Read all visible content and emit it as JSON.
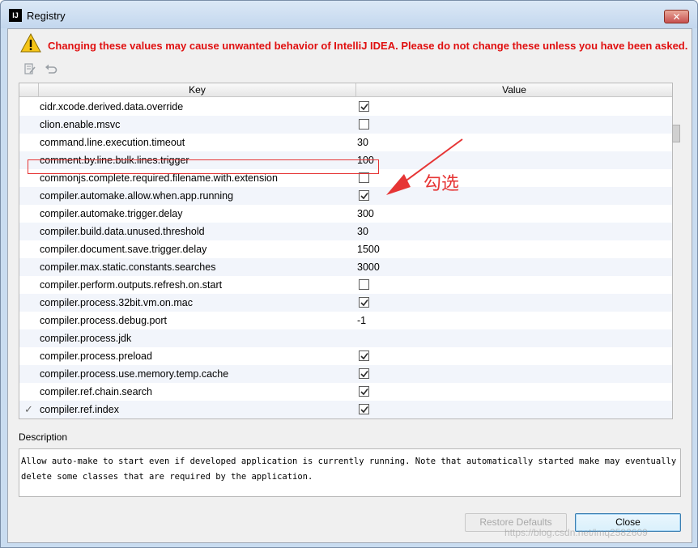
{
  "window": {
    "title": "Registry",
    "app_icon": "IJ"
  },
  "warning": {
    "text": "Changing these values may cause unwanted behavior of IntelliJ IDEA. Please do not change these unless you have been asked."
  },
  "table": {
    "columns": {
      "key": "Key",
      "value": "Value"
    },
    "rows": [
      {
        "key": "cidr.xcode.derived.data.override",
        "type": "checkbox",
        "checked": true,
        "value": ""
      },
      {
        "key": "clion.enable.msvc",
        "type": "checkbox",
        "checked": false,
        "value": ""
      },
      {
        "key": "command.line.execution.timeout",
        "type": "text",
        "value": "30"
      },
      {
        "key": "comment.by.line.bulk.lines.trigger",
        "type": "text",
        "value": "100"
      },
      {
        "key": "commonjs.complete.required.filename.with.extension",
        "type": "checkbox",
        "checked": false,
        "value": ""
      },
      {
        "key": "compiler.automake.allow.when.app.running",
        "type": "checkbox",
        "checked": true,
        "value": "",
        "highlighted": true
      },
      {
        "key": "compiler.automake.trigger.delay",
        "type": "text",
        "value": "300"
      },
      {
        "key": "compiler.build.data.unused.threshold",
        "type": "text",
        "value": "30"
      },
      {
        "key": "compiler.document.save.trigger.delay",
        "type": "text",
        "value": "1500"
      },
      {
        "key": "compiler.max.static.constants.searches",
        "type": "text",
        "value": "3000"
      },
      {
        "key": "compiler.perform.outputs.refresh.on.start",
        "type": "checkbox",
        "checked": false,
        "value": ""
      },
      {
        "key": "compiler.process.32bit.vm.on.mac",
        "type": "checkbox",
        "checked": true,
        "value": ""
      },
      {
        "key": "compiler.process.debug.port",
        "type": "text",
        "value": "-1"
      },
      {
        "key": "compiler.process.jdk",
        "type": "text",
        "value": ""
      },
      {
        "key": "compiler.process.preload",
        "type": "checkbox",
        "checked": true,
        "value": ""
      },
      {
        "key": "compiler.process.use.memory.temp.cache",
        "type": "checkbox",
        "checked": true,
        "value": ""
      },
      {
        "key": "compiler.ref.chain.search",
        "type": "checkbox",
        "checked": true,
        "value": ""
      },
      {
        "key": "compiler.ref.index",
        "type": "checkbox",
        "checked": true,
        "value": "",
        "modified": true
      }
    ]
  },
  "annotation": {
    "text": "勾选",
    "color": "#e63535"
  },
  "description": {
    "label": "Description",
    "text": "Allow auto-make to start even if developed application is currently running. Note that automatically started make may eventually delete some classes that are required by the application."
  },
  "buttons": {
    "restore_defaults": "Restore Defaults",
    "close": "Close"
  },
  "watermark": "https://blog.csdn.net/lmq2582609",
  "colors": {
    "warning": "#e01010",
    "accent": "#3c7fb1"
  }
}
